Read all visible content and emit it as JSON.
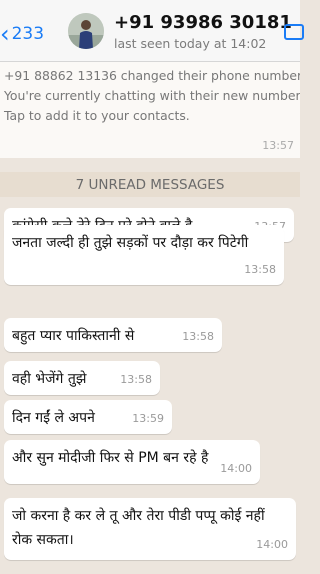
{
  "header": {
    "back_count": "233",
    "contact_name": "+91 93986 30181",
    "status": "last seen today at 14:02"
  },
  "system_message": {
    "lines": [
      "+91 88862 13136 changed their phone number.",
      "You're currently chatting with their new number.",
      "Tap to add it to your contacts."
    ],
    "time": "13:57"
  },
  "unread_banner": "7 UNREAD MESSAGES",
  "messages": [
    {
      "text": "कांग्रेसी कुत्ते तेरे दिन पूरे होने वाले है",
      "time": "13:57"
    },
    {
      "text": "जनता जल्दी ही तुझे सड़कों पर दौड़ा कर पिटेगी",
      "time": "13:58"
    },
    {
      "text": "बहुत प्यार पाकिस्तानी से",
      "time": "13:58"
    },
    {
      "text": "वही भेजेंगे तुझे",
      "time": "13:58"
    },
    {
      "text": "दिन गईं ले अपने",
      "time": "13:59"
    },
    {
      "text": "और सुन मोदीजी फिर से PM बन रहे है",
      "time": "14:00"
    },
    {
      "text": "जो करना है कर ले तू और तेरा पीडी पप्पू कोई नहीं रोक सकता।",
      "time": "14:00"
    }
  ],
  "colors": {
    "accent": "#1a7cf6",
    "chat_background": "#ece5dd",
    "bubble": "#ffffff"
  },
  "icons": {
    "back": "chevron-left-icon",
    "video": "video-call-icon"
  }
}
